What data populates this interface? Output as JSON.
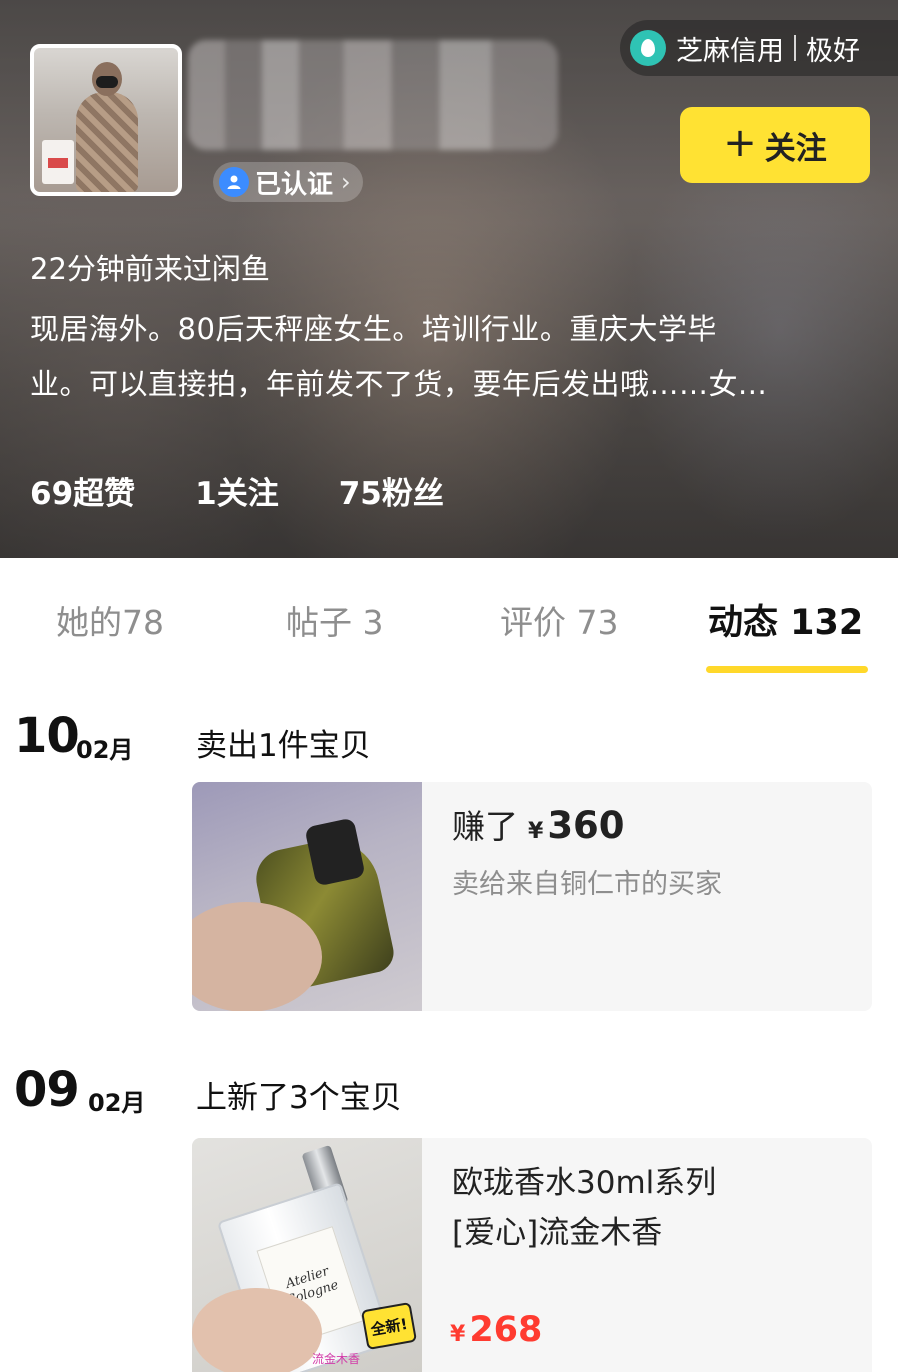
{
  "profile": {
    "verified_label": "已认证",
    "credit_label": "芝麻信用",
    "credit_value": "极好",
    "follow_button": "关注",
    "last_seen": "22分钟前来过闲鱼",
    "bio_line1": "现居海外。80后天秤座女生。培训行业。重庆大学毕",
    "bio_line2": "业。可以直接拍，年前发不了货，要年后发出哦……女...",
    "stats": {
      "likes": "69超赞",
      "following": "1关注",
      "fans": "75粉丝"
    }
  },
  "tabs": [
    {
      "label": "她的78"
    },
    {
      "label": "帖子 3"
    },
    {
      "label": "评价 73"
    },
    {
      "label": "动态 132"
    }
  ],
  "active_tab": "动态 132",
  "colors": {
    "accent": "#ffe233",
    "price": "#ff3b30",
    "underline": "#ffd82a"
  },
  "feed": [
    {
      "day": "10",
      "month": "02月",
      "title": "卖出1件宝贝",
      "card": {
        "earn_label": "赚了",
        "currency": "¥",
        "amount": "360",
        "buyer": "卖给来自铜仁市的买家"
      }
    },
    {
      "day": "09",
      "month": "02月",
      "title": "上新了3个宝贝",
      "card": {
        "title_line1": "欧珑香水30ml系列",
        "title_line2": "[爱心]流金木香",
        "currency": "¥",
        "price": "268",
        "thumb_label": "Atelier Cologne",
        "thumb_sticker": "全新!",
        "thumb_caption": "流金木香"
      }
    }
  ]
}
